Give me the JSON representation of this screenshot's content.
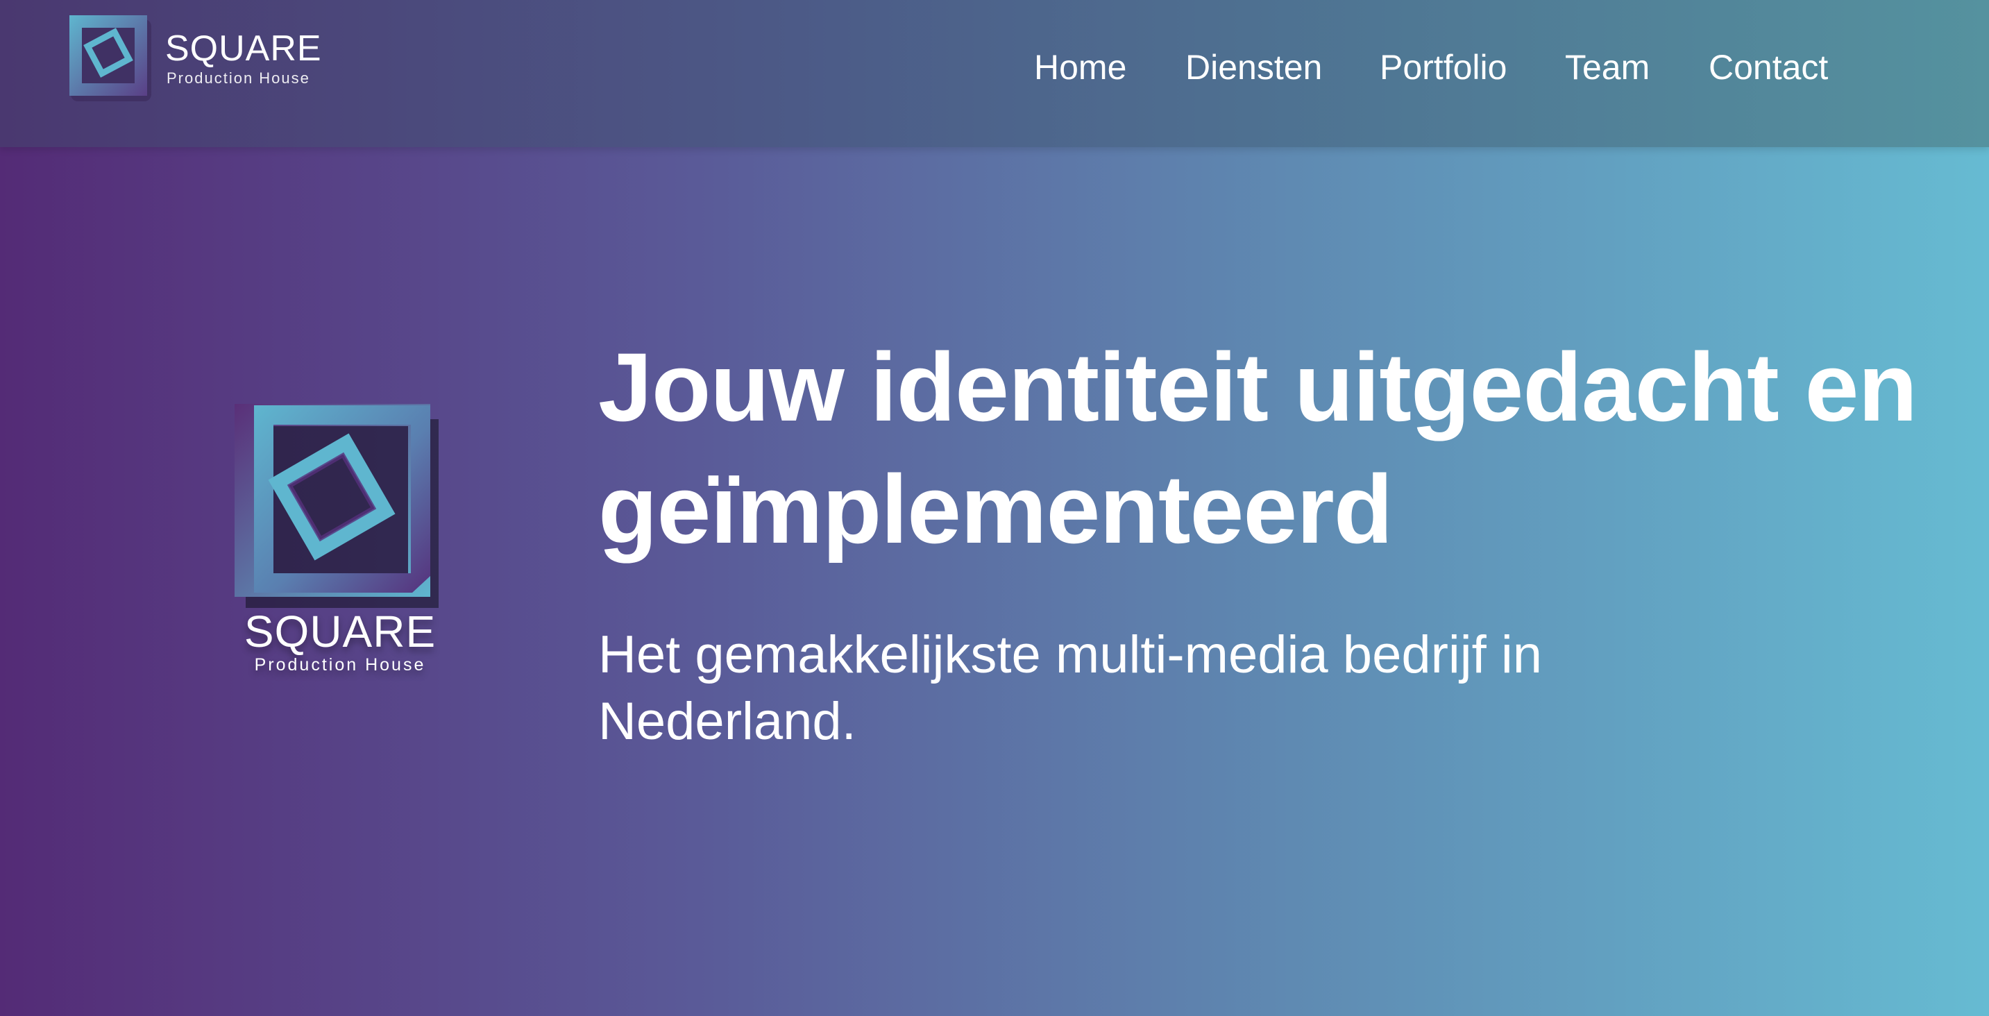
{
  "brand": {
    "name": "SQUARE",
    "tagline": "Production House"
  },
  "nav": {
    "items": [
      {
        "label": "Home"
      },
      {
        "label": "Diensten"
      },
      {
        "label": "Portfolio"
      },
      {
        "label": "Team"
      },
      {
        "label": "Contact"
      }
    ]
  },
  "hero": {
    "logo_name": "SQUARE",
    "logo_tagline": "Production House",
    "headline": "Jouw identiteit uitgedacht en geïmplementeerd",
    "subtext": "Het gemakkelijkste multi-media bedrijf in Nederland."
  },
  "colors": {
    "logo_teal": "#5fb6cf",
    "logo_purple": "#5a2f78",
    "gradient_left": "#542b76",
    "gradient_right": "#66bbd2"
  }
}
